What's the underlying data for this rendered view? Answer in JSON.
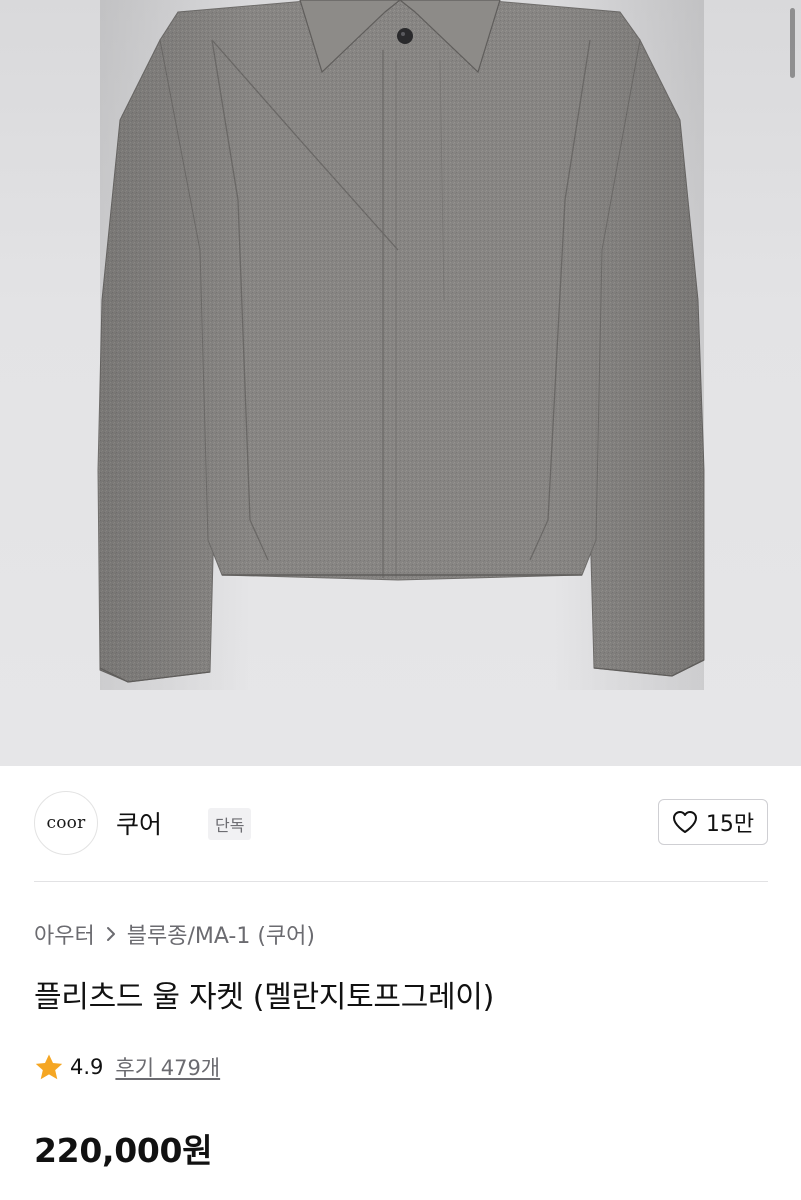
{
  "brand": {
    "logo_text": "coor",
    "name": "쿠어",
    "badge": "단독"
  },
  "like": {
    "icon": "heart-outline-icon",
    "count": "15만"
  },
  "breadcrumb": {
    "category": "아우터",
    "separator_icon": "chevron-right-icon",
    "subcategory": "블루종/MA-1 (쿠어)"
  },
  "product": {
    "title": "플리츠드 울 자켓 (멜란지토프그레이)",
    "rating_icon": "star-icon",
    "rating": "4.9",
    "reviews_label": "후기 479개",
    "price": "220,000원"
  },
  "colors": {
    "rating_star": "#f5a623",
    "jacket_gray": "#8a8886",
    "background_gray": "#e3e3e5"
  }
}
